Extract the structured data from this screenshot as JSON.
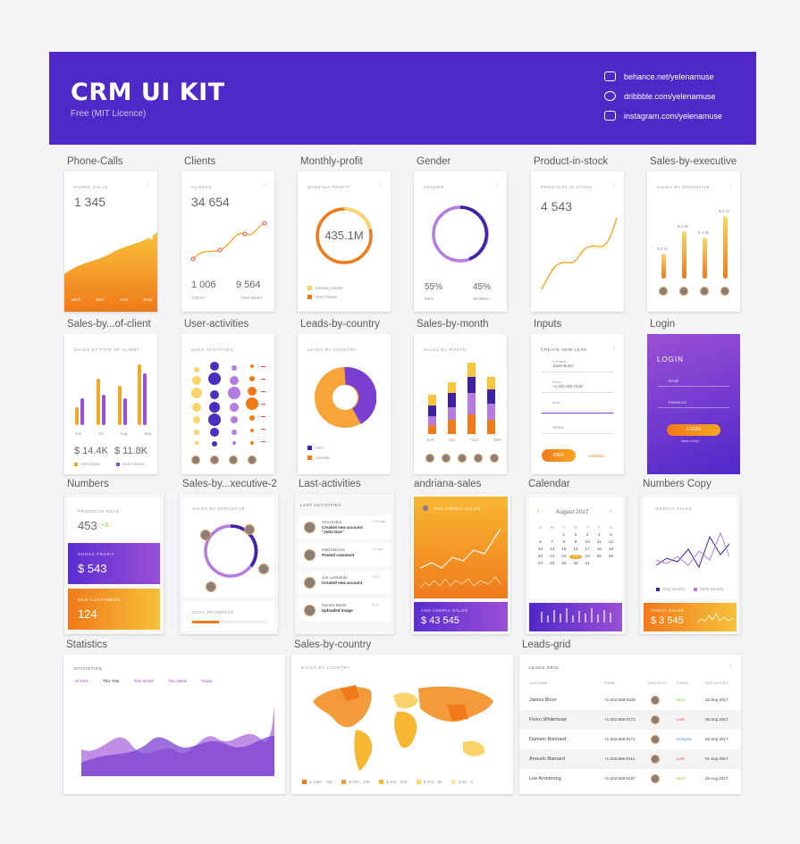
{
  "header": {
    "title": "CRM UI KIT",
    "subtitle": "Free (MIT Licence)",
    "links": [
      "behance.net/yelenamuse",
      "dribbble.com/yelenamuse",
      "instagram.com/yelenamuse"
    ]
  },
  "labels": [
    "Phone-Calls",
    "Clients",
    "Monthly-profit",
    "Gender",
    "Product-in-stock",
    "Sales-by-executive",
    "Sales-by...of-client",
    "User-activities",
    "Leads-by-country",
    "Sales-by-month",
    "Inputs",
    "Login",
    "Numbers",
    "Sales-by...xecutive-2",
    "Last-activities",
    "andriana-sales",
    "Calendar",
    "Numbers Copy",
    "Statistics",
    "Sales-by-country",
    "Leads-grid"
  ],
  "phone": {
    "title": "PHONE CALLS",
    "value": "1 345",
    "ticks": [
      "MAR",
      "MAY",
      "JUN",
      "AUG"
    ]
  },
  "clients": {
    "title": "CLIENTS",
    "value": "34 654",
    "today_val": "1 006",
    "today": "TODAY",
    "week_val": "9 564",
    "week": "THIS WEEK"
  },
  "profit": {
    "title": "MONTHLY PROFIT",
    "value": "435.1M",
    "legend": [
      "Existing Clients",
      "New Clients"
    ]
  },
  "gender": {
    "title": "GENDER",
    "men_pct": "55%",
    "men": "MEN",
    "women_pct": "45%",
    "women": "WOMEN"
  },
  "stock": {
    "title": "PRODUCTS IN STOCK",
    "value": "4 543"
  },
  "exec": {
    "title": "SALES BY EXECUTIVE",
    "values": [
      "$ 2.1k",
      "$ 4.5k",
      "$ 3.6k",
      "$ 5.2k"
    ]
  },
  "typeclient": {
    "title": "SALES BY TYPE OF CLIENT",
    "months": [
      "Jun",
      "Jul",
      "Aug",
      "Sep"
    ],
    "v1": "$ 14.4K",
    "v2": "$ 11.8K",
    "legend": [
      "Old Clients",
      "New Clients"
    ]
  },
  "useract": {
    "title": "USER ACTIVITIES"
  },
  "leads": {
    "title": "LEADS BY COUNTRY",
    "legend": [
      "USA",
      "Canada"
    ]
  },
  "salesmonth": {
    "title": "SALES BY MONTH",
    "months": [
      "JUN",
      "JUL",
      "AUG",
      "SEP"
    ]
  },
  "inputs": {
    "title": "CREATE NEW LEAD",
    "name_label": "Full Name",
    "name_value": "Janet Bond",
    "phone_label": "Phone",
    "phone_value": "+1 202 555 0136",
    "email_label": "Email",
    "status": "Status",
    "save": "SAVE",
    "cancel": "CANCEL"
  },
  "login": {
    "title": "LOGIN",
    "email": "Email",
    "password": "Password",
    "button": "LOGIN",
    "forgot": "Need a help?"
  },
  "numbers": {
    "sold_label": "PRODUCTS SOLD",
    "sold": "453",
    "sold_delta": "+3",
    "gross_label": "GROSS PROFIT",
    "gross": "$ 543",
    "new_label": "NEW CUSTOMERS",
    "new": "124"
  },
  "exec2": {
    "title": "SALES BY EXECUTIVE",
    "goal": "GOAL PROGRESS"
  },
  "lastact": {
    "title": "LAST ACTIVITIES",
    "items": [
      {
        "name": "Ann Andria",
        "text": "Created new account: \"John Doe\"",
        "time": "1 min ago"
      },
      {
        "name": "Matt Machos",
        "text": "Posted comment",
        "time": "2 hr ago"
      },
      {
        "name": "Joe Lombardo",
        "text": "Created new account",
        "time": "13:12"
      },
      {
        "name": "Monica Borak",
        "text": "Uploaded image",
        "time": "11:21"
      }
    ]
  },
  "andriana": {
    "name": "ANN ANDRIA SALES",
    "label": "ANN ANDRIA SALES",
    "value": "$ 43 545"
  },
  "calendar": {
    "month": "August 2017",
    "days": [
      "S",
      "M",
      "T",
      "W",
      "T",
      "F",
      "S"
    ]
  },
  "numcopy": {
    "title": "WEEKLY SALES",
    "legend": [
      "OLD LEADS",
      "NEW LEADS"
    ],
    "today_label": "TODAY SALES",
    "today": "$ 3 545"
  },
  "stats": {
    "title": "STATISTICS",
    "tabs": [
      "All Time",
      "This Year",
      "This Month",
      "This Week",
      "Today"
    ]
  },
  "country": {
    "title": "SALES BY COUNTRY",
    "legend": [
      "$ 100K - 70K",
      "$ 70K - 40K",
      "$ 40K - 20K",
      "$ 20K - 5K",
      "$ 5K - 0"
    ],
    "colors": [
      "#f07a1a",
      "#f39a3a",
      "#f7b733",
      "#f9d46a",
      "#fbe7a8"
    ]
  },
  "grid": {
    "title": "LEADS GRID",
    "headers": [
      "LEAD NAME",
      "PHONE",
      "CREATED BY",
      "STATUS",
      "LAST UPDATED"
    ],
    "rows": [
      {
        "name": "James Bloor",
        "phone": "+1-202-555-0109",
        "status": "Won",
        "date": "10 Sep 2017"
      },
      {
        "name": "Fionn Whitehead",
        "phone": "+1-202-555-0172",
        "status": "Lost",
        "date": "05 Sep 2017"
      },
      {
        "name": "Damien Bonnard",
        "phone": "+1-202-555-0171",
        "status": "Delayed",
        "date": "05 Sep 2017"
      },
      {
        "name": "Aneurin Barnard",
        "phone": "+1-202-555-0112",
        "status": "Lost",
        "date": "01 Sep 2017"
      },
      {
        "name": "Lee Armstrong",
        "phone": "+1-202-555-0137",
        "status": "Won",
        "date": "25 Aug 2017"
      }
    ]
  },
  "colors": {
    "purple": "#4f28c8",
    "orange": "#f5a623",
    "won": "#7ed321",
    "lost": "#e94b3c",
    "delayed": "#4a90e2"
  }
}
